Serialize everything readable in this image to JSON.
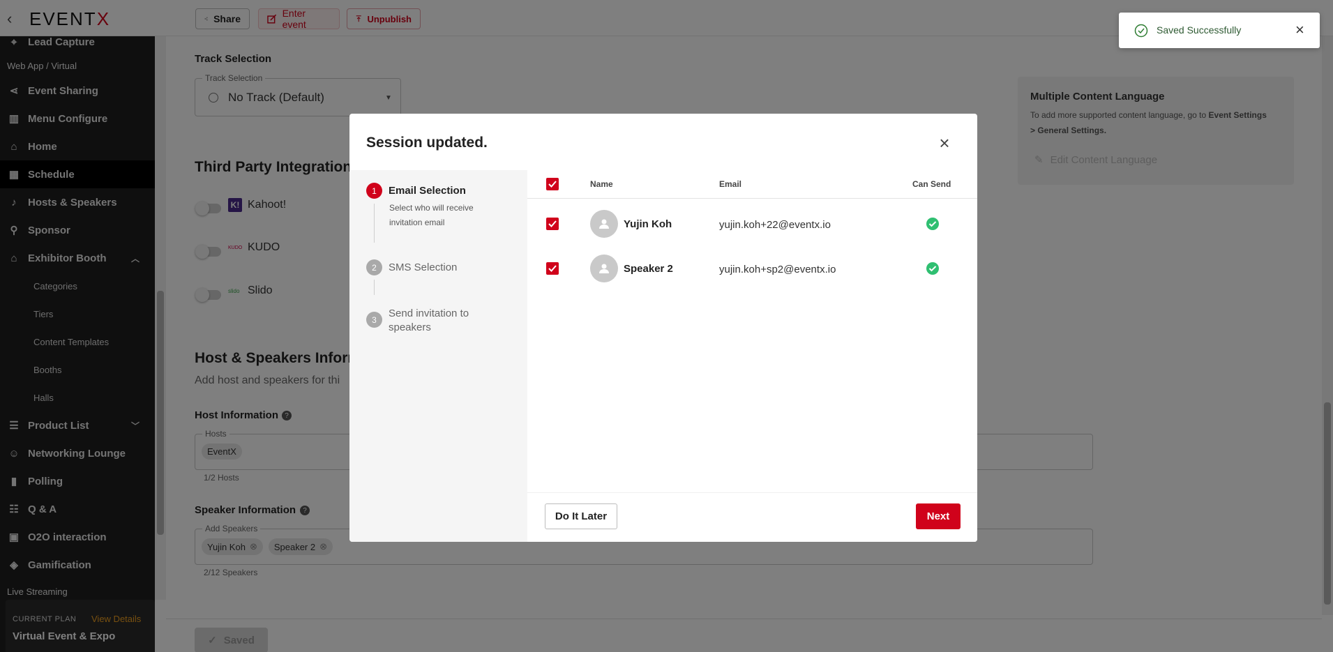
{
  "app": {
    "logo_main": "EVENT",
    "logo_accent": "X"
  },
  "toolbar": {
    "share_label": "Share",
    "enter_label": "Enter event",
    "unpublish_label": "Unpublish"
  },
  "sidebar": {
    "items": [
      {
        "label": "Lead Capture",
        "icon": "lead-icon"
      },
      {
        "label": "Web App / Virtual",
        "icon": ""
      },
      {
        "label": "Event Sharing",
        "icon": "share-icon"
      },
      {
        "label": "Menu Configure",
        "icon": "menu-icon"
      },
      {
        "label": "Home",
        "icon": "home-icon"
      },
      {
        "label": "Schedule",
        "icon": "calendar-icon"
      },
      {
        "label": "Hosts & Speakers",
        "icon": "mic-icon"
      },
      {
        "label": "Sponsor",
        "icon": "sponsor-icon"
      },
      {
        "label": "Exhibitor Booth",
        "icon": "booth-icon"
      },
      {
        "label": "Product List",
        "icon": "product-icon"
      },
      {
        "label": "Networking Lounge",
        "icon": "lounge-icon"
      },
      {
        "label": "Polling",
        "icon": "poll-icon"
      },
      {
        "label": "Q & A",
        "icon": "qa-icon"
      },
      {
        "label": "O2O interaction",
        "icon": "o2o-icon"
      },
      {
        "label": "Gamification",
        "icon": "game-icon"
      },
      {
        "label": "Live Streaming",
        "icon": ""
      }
    ],
    "booth_sub": [
      "Categories",
      "Tiers",
      "Content Templates",
      "Booths",
      "Halls"
    ],
    "plan": {
      "label": "CURRENT PLAN",
      "view_details": "View Details",
      "name": "Virtual Event & Expo"
    }
  },
  "main": {
    "track": {
      "heading": "Track Selection",
      "legend": "Track Selection",
      "value": "No Track (Default)"
    },
    "integrations": {
      "heading": "Third Party Integration",
      "items": [
        "Kahoot!",
        "KUDO",
        "Slido"
      ]
    },
    "hosts_section": {
      "heading": "Host & Speakers Inform",
      "subtitle": "Add host and speakers for thi"
    },
    "host_info": {
      "label": "Host Information",
      "legend": "Hosts",
      "chips": [
        "EventX"
      ],
      "helper": "1/2 Hosts"
    },
    "speaker_info": {
      "label": "Speaker Information",
      "legend": "Add Speakers",
      "chips": [
        "Yujin Koh",
        "Speaker 2"
      ],
      "helper": "2/12 Speakers"
    },
    "language": {
      "title": "Multiple Content Language",
      "desc_pre": "To add more supported content language, go to ",
      "desc_bold": "Event Settings > General Settings.",
      "edit_label": "Edit Content Language"
    },
    "saved_label": "Saved"
  },
  "modal": {
    "title": "Session updated.",
    "steps": [
      {
        "num": "1",
        "label": "Email Selection",
        "desc": "Select who will receive invitation email"
      },
      {
        "num": "2",
        "label": "SMS Selection",
        "desc": ""
      },
      {
        "num": "3",
        "label": "Send invitation to speakers",
        "desc": ""
      }
    ],
    "columns": {
      "name": "Name",
      "email": "Email",
      "can_send": "Can Send"
    },
    "rows": [
      {
        "name": "Yujin Koh",
        "email": "yujin.koh+22@eventx.io",
        "checked": true,
        "can_send": true
      },
      {
        "name": "Speaker 2",
        "email": "yujin.koh+sp2@eventx.io",
        "checked": true,
        "can_send": true
      }
    ],
    "later_label": "Do It Later",
    "next_label": "Next"
  },
  "toast": {
    "message": "Saved Successfully"
  },
  "colors": {
    "accent": "#d0021b",
    "success": "#2fbf71",
    "sidebar_bg": "#1e1e1e"
  }
}
